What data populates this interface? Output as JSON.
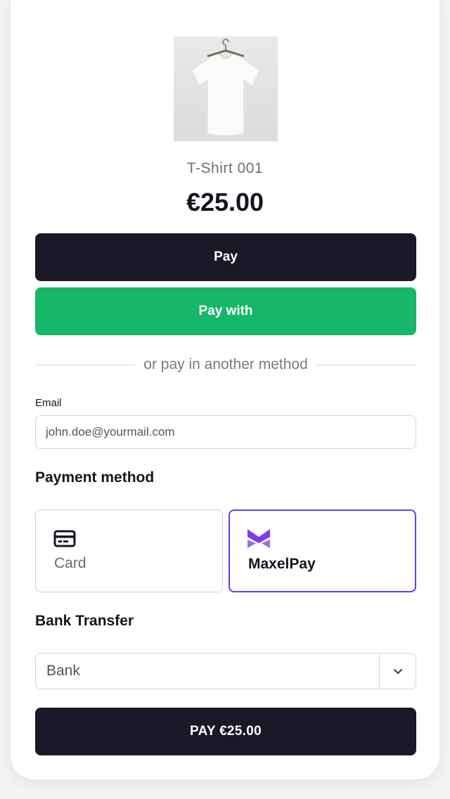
{
  "product": {
    "image_alt": "white t-shirt on hanger",
    "name": "T-Shirt 001",
    "price": "€25.00"
  },
  "buttons": {
    "pay": "Pay",
    "pay_with": "Pay with",
    "final_pay": "PAY €25.00"
  },
  "divider": {
    "text": "or pay in another method"
  },
  "email": {
    "label": "Email",
    "placeholder": "john.doe@yourmail.com"
  },
  "payment_method": {
    "title": "Payment method",
    "options": [
      {
        "label": "Card",
        "icon": "credit-card-icon",
        "selected": false
      },
      {
        "label": "MaxelPay",
        "icon": "maxelpay-logo-icon",
        "selected": true
      }
    ]
  },
  "bank_transfer": {
    "title": "Bank Transfer",
    "selected": "Bank"
  },
  "colors": {
    "dark_button": "#1b1928",
    "green_button": "#16b769",
    "accent_purple": "#6d3ae6"
  }
}
